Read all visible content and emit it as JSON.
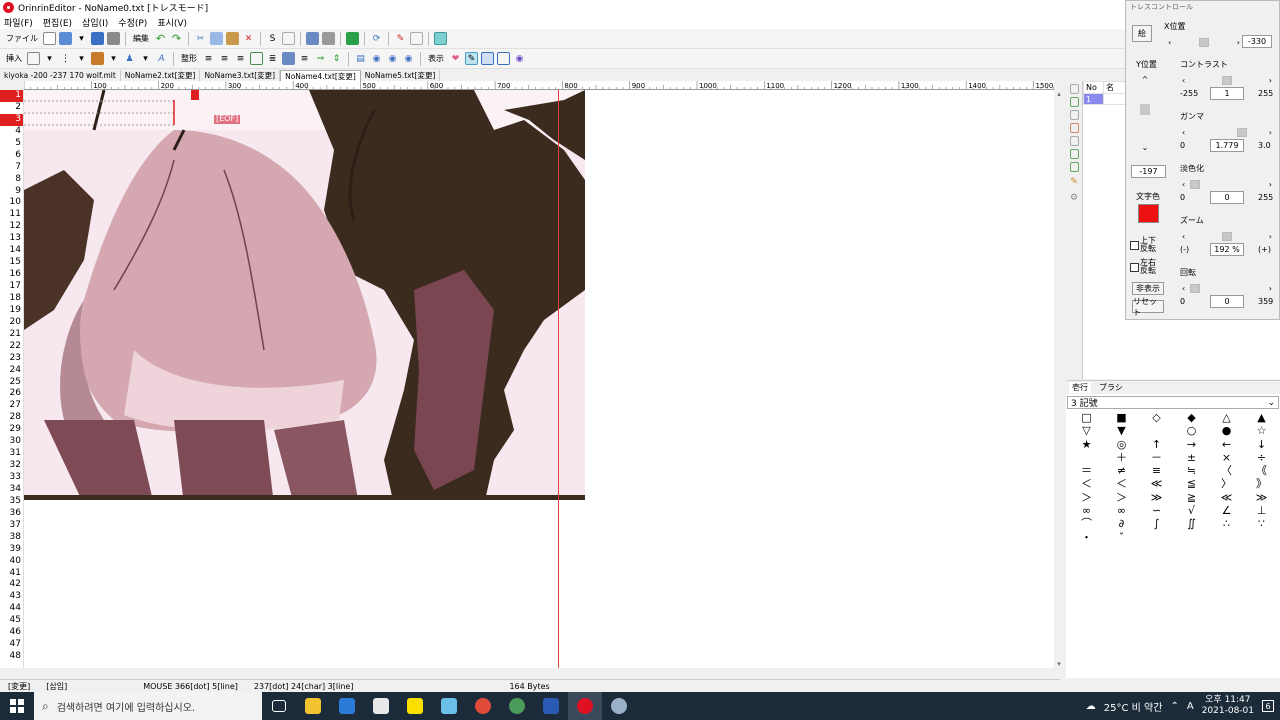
{
  "window": {
    "title": "OrinrinEditor - NoName0.txt [トレスモード]"
  },
  "menu": [
    "파일(F)",
    "편집(E)",
    "삽입(I)",
    "수정(P)",
    "표시(V)"
  ],
  "toolbar": {
    "file_label": "ファイル",
    "edit_label": "編集",
    "insert_label": "挿入",
    "format_label": "整形",
    "view_label": "表示"
  },
  "tabs": [
    "kiyoka -200 -237 170 wolf.mlt",
    "NoName2.txt[変更]",
    "NoName3.txt[変更]",
    "NoName4.txt[変更]",
    "NoName5.txt[変更]"
  ],
  "ruler": [
    "100",
    "200",
    "300",
    "400",
    "500",
    "600",
    "700",
    "800",
    "900",
    "1000",
    "1100",
    "1200",
    "1300",
    "1400",
    "1500"
  ],
  "line_numbers": [
    "1",
    "2",
    "3",
    "4",
    "5",
    "6",
    "7",
    "8",
    "9",
    "10",
    "11",
    "12",
    "13",
    "14",
    "15",
    "16",
    "17",
    "18",
    "19",
    "20",
    "21",
    "22",
    "23",
    "24",
    "25",
    "26",
    "27",
    "28",
    "29",
    "30",
    "31",
    "32",
    "33",
    "34",
    "35",
    "36",
    "37",
    "38",
    "39",
    "40",
    "41",
    "42",
    "43",
    "44",
    "45",
    "46",
    "47",
    "48"
  ],
  "editor": {
    "eof_marker": "[EOF]"
  },
  "status": {
    "mode": "[変更]",
    "insert": "[삽입]",
    "mouse": "MOUSE 366[dot] 5[line]",
    "cursor": "237[dot] 24[char] 3[line]",
    "size": "164 Bytes"
  },
  "list": {
    "col_no": "No",
    "col_name": "名",
    "row1": "1"
  },
  "char_panel": {
    "tab_active": "壱行",
    "tab_other": "ブラシ",
    "category": "3 記號",
    "chars": [
      "□",
      "■",
      "◇",
      "◆",
      "△",
      "▲",
      "▽",
      "▼",
      "",
      "○",
      "●",
      "☆",
      "★",
      "◎",
      "↑",
      "→",
      "←",
      "↓",
      "",
      "＋",
      "－",
      "±",
      "×",
      "÷",
      "＝",
      "≠",
      "≡",
      "≒",
      "〈",
      "《",
      "＜",
      "＜",
      "≪",
      "≦",
      "〉",
      "》",
      "＞",
      "＞",
      "≫",
      "≧",
      "≪",
      "≫",
      "∞",
      "∞",
      "∽",
      "√",
      "∠",
      "⊥",
      "⌒",
      "∂",
      "∫",
      "∬",
      "∴",
      "∵",
      "・",
      "ˇ",
      "",
      "",
      "",
      ""
    ]
  },
  "trace": {
    "title": "トレスコントロール",
    "frame_btn": "絵",
    "x_label": "X位置",
    "x_value": "-330",
    "y_label": "Y位置",
    "y_value": "-197",
    "contrast_label": "コントラスト",
    "contrast_min": "-255",
    "contrast_value": "1",
    "contrast_max": "255",
    "gamma_label": "ガンマ",
    "gamma_min": "0",
    "gamma_value": "1.779",
    "gamma_max": "3.0",
    "fade_label": "淡色化",
    "fade_min": "0",
    "fade_value": "0",
    "fade_max": "255",
    "textcolor_label": "文字色",
    "textcolor": "#ee1111",
    "zoom_label": "ズーム",
    "zoom_minus": "(-)",
    "zoom_value": "192 %",
    "zoom_plus": "(+)",
    "flipv_label": "上下反転",
    "fliph_label": "左右反転",
    "rotate_label": "回転",
    "rotate_min": "0",
    "rotate_value": "0",
    "rotate_max": "359",
    "hide_btn": "非表示",
    "reset_btn": "リセット"
  },
  "taskbar": {
    "search_placeholder": "검색하려면 여기에 입력하십시오.",
    "weather": "25°C 비 약간",
    "ime": "A",
    "time": "오후 11:47",
    "date": "2021-08-01",
    "notif_count": "6"
  }
}
